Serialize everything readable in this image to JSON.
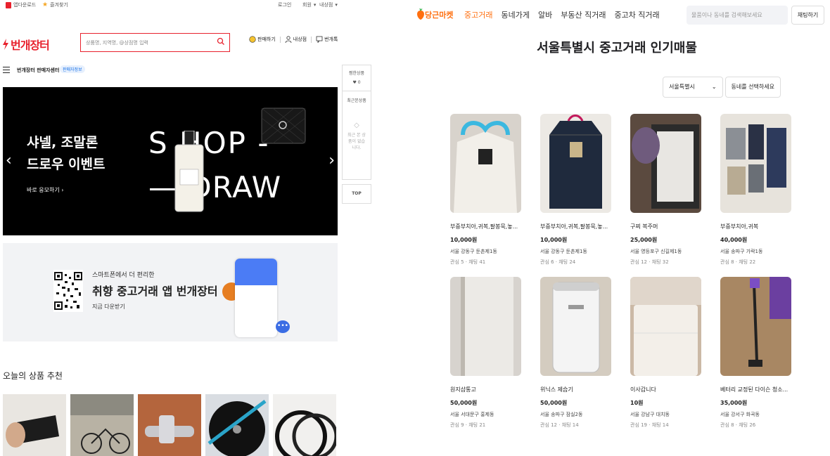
{
  "left": {
    "util": {
      "app_download": "앱다운로드",
      "favorite": "즐겨찾기",
      "login": "로그인",
      "signup": "회원",
      "my_shop": "내상점"
    },
    "header": {
      "logo": "번개장터",
      "search_placeholder": "상품명, 지역명, @상점명 입력",
      "sell": "판매하기",
      "my_store": "내상점",
      "talk": "번개톡"
    },
    "category": {
      "label": "번개장터 판매자센터",
      "badge": "판매자정보"
    },
    "banner": {
      "title_line1": "샤넬, 조말론",
      "title_line2": "드로우 이벤트",
      "cta": "바로 응모하기",
      "shop_text": "S HOP -",
      "draw_text": "— DRAW"
    },
    "app_banner": {
      "line1": "스마트폰에서 더 편리한",
      "line2": "취향 중고거래 앱 번개장터",
      "line3": "지금 다운받기"
    },
    "recommend_title": "오늘의 상품 추천",
    "side": {
      "wish_label": "찜한상품",
      "wish_count": "♥ 0",
      "recent_label": "최근본상품",
      "recent_empty": "최근 본 상품이 없습니다.",
      "top": "TOP"
    }
  },
  "right": {
    "logo": "당근마켓",
    "nav": [
      "중고거래",
      "동네가게",
      "알바",
      "부동산 직거래",
      "중고차 직거래"
    ],
    "search_placeholder": "물품이나 동네를 검색해보세요",
    "chat_button": "채팅하기",
    "title": "서울특별시 중고거래 인기매물",
    "filter_region": "서울특별시",
    "filter_dong": "동네를 선택하세요",
    "items": [
      {
        "name": "부중부치아,귀복,팔봉묵,놓...",
        "price": "10,000원",
        "loc": "서울 강동구 둔촌제1동",
        "meta": "관심 5 · 채팅 41"
      },
      {
        "name": "부중부치아,귀복,팔봉묵,놓...",
        "price": "10,000원",
        "loc": "서울 강동구 둔촌제1동",
        "meta": "관심 6 · 채팅 24"
      },
      {
        "name": "구찌 복주머",
        "price": "25,000원",
        "loc": "서울 영등포구 신길제1동",
        "meta": "관심 12 · 채팅 32"
      },
      {
        "name": "부중부치아,귀복",
        "price": "40,000원",
        "loc": "서울 송파구 가락1동",
        "meta": "관심 8 · 채팅 22"
      },
      {
        "name": "원지샵통고",
        "price": "50,000원",
        "loc": "서울 서대문구 홍제동",
        "meta": "관심 9 · 채팅 21"
      },
      {
        "name": "위닉스 제습기",
        "price": "50,000원",
        "loc": "서울 송파구 잠실2동",
        "meta": "관심 12 · 채팅 14"
      },
      {
        "name": "이사갑니다",
        "price": "10원",
        "loc": "서울 강남구 대치동",
        "meta": "관심 19 · 채팅 14"
      },
      {
        "name": "베터리 교정된 다이슨 청소...",
        "price": "35,000원",
        "loc": "서울 강서구 화곡동",
        "meta": "관심 8 · 채팅 26"
      }
    ]
  }
}
